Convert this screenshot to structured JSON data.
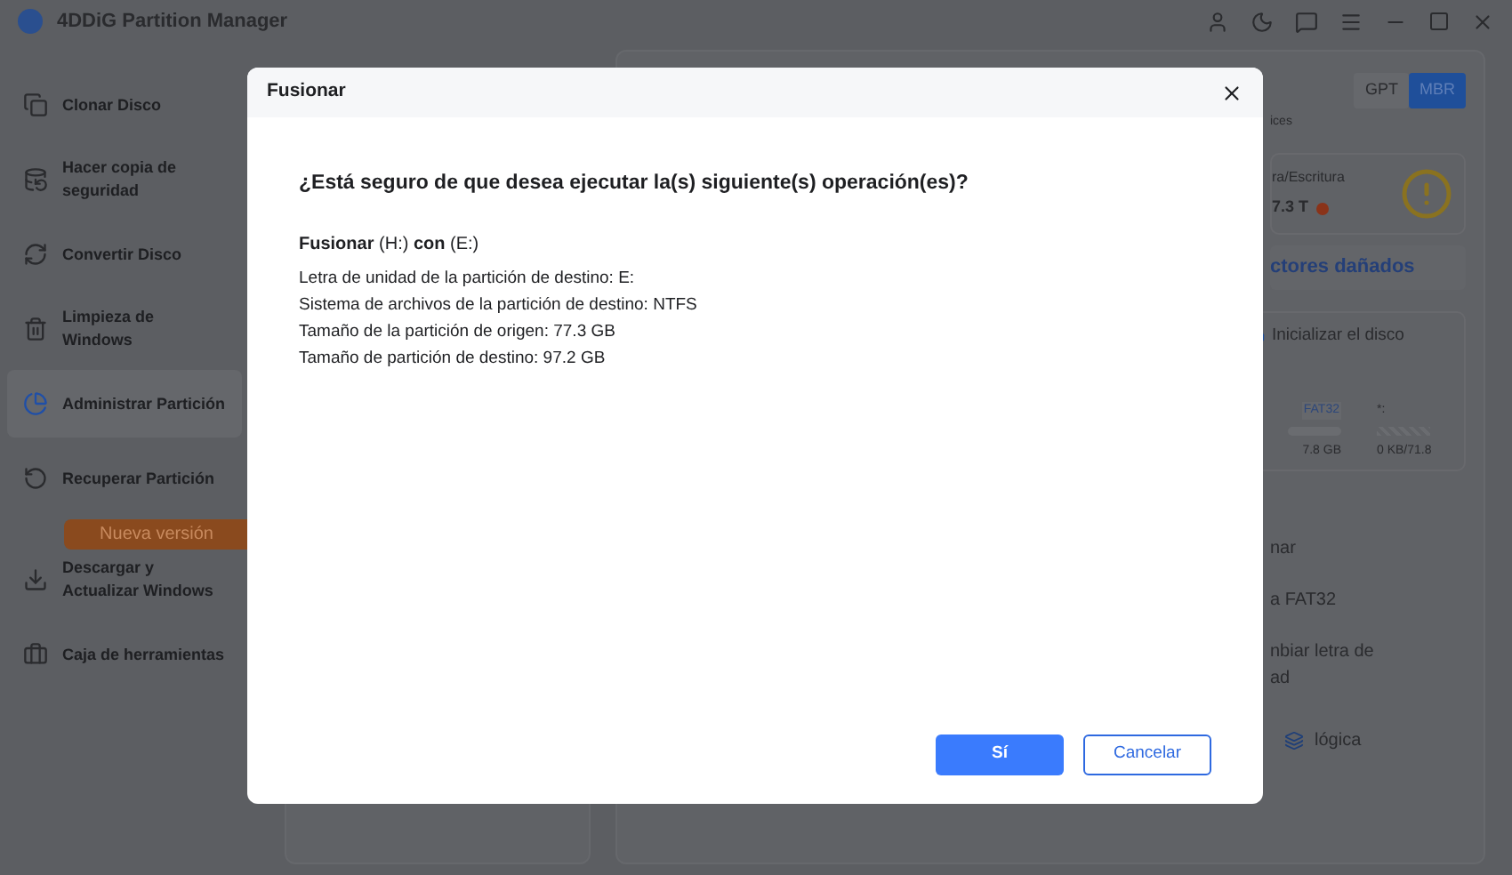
{
  "window": {
    "title": "4DDiG Partition Manager"
  },
  "sidebar": {
    "items": [
      {
        "label": "Clonar Disco",
        "selected": false
      },
      {
        "label": "Hacer copia de seguridad",
        "selected": false
      },
      {
        "label": "Convertir Disco",
        "selected": false
      },
      {
        "label": "Limpieza de Windows",
        "selected": false
      },
      {
        "label": "Administrar Partición",
        "selected": true
      },
      {
        "label": "Recuperar Partición",
        "selected": false
      },
      {
        "label": "Descargar y Actualizar Windows",
        "selected": false,
        "badge": "Nueva versión"
      },
      {
        "label": "Caja de herramientas",
        "selected": false
      }
    ]
  },
  "disk_panel": {
    "styles": [
      {
        "label": "GPT",
        "selected": false
      },
      {
        "label": "MBR",
        "selected": true
      }
    ],
    "note": "ices",
    "health_label": "ra/Escritura",
    "health_value": "7.3 T",
    "bad_sectors": "ctores dañados",
    "init_button": "Inicializar el disco",
    "partition": {
      "file_system": "FAT32",
      "letter": "*:",
      "used": "7.8 GB",
      "usage": "0 KB/71.8"
    },
    "actions": [
      "nar",
      "a FAT32",
      "nbiar letra de",
      "ad"
    ],
    "bottom_action": "lógica"
  },
  "dialog": {
    "title": "Fusionar",
    "question": "¿Está seguro de que desea ejecutar la(s) siguiente(s) operación(es)?",
    "operation": "**Fusionar** (H:) **con** (E:)",
    "details": [
      "Letra de unidad de la partición de destino: E:",
      "Sistema de archivos de la partición de destino: NTFS",
      "Tamaño de la partición de origen: 77.3 GB",
      "Tamaño de partición de destino: 97.2 GB"
    ],
    "buttons": [
      {
        "label": "Sí",
        "kind": "primary"
      },
      {
        "label": "Cancelar",
        "kind": "secondary"
      }
    ]
  }
}
